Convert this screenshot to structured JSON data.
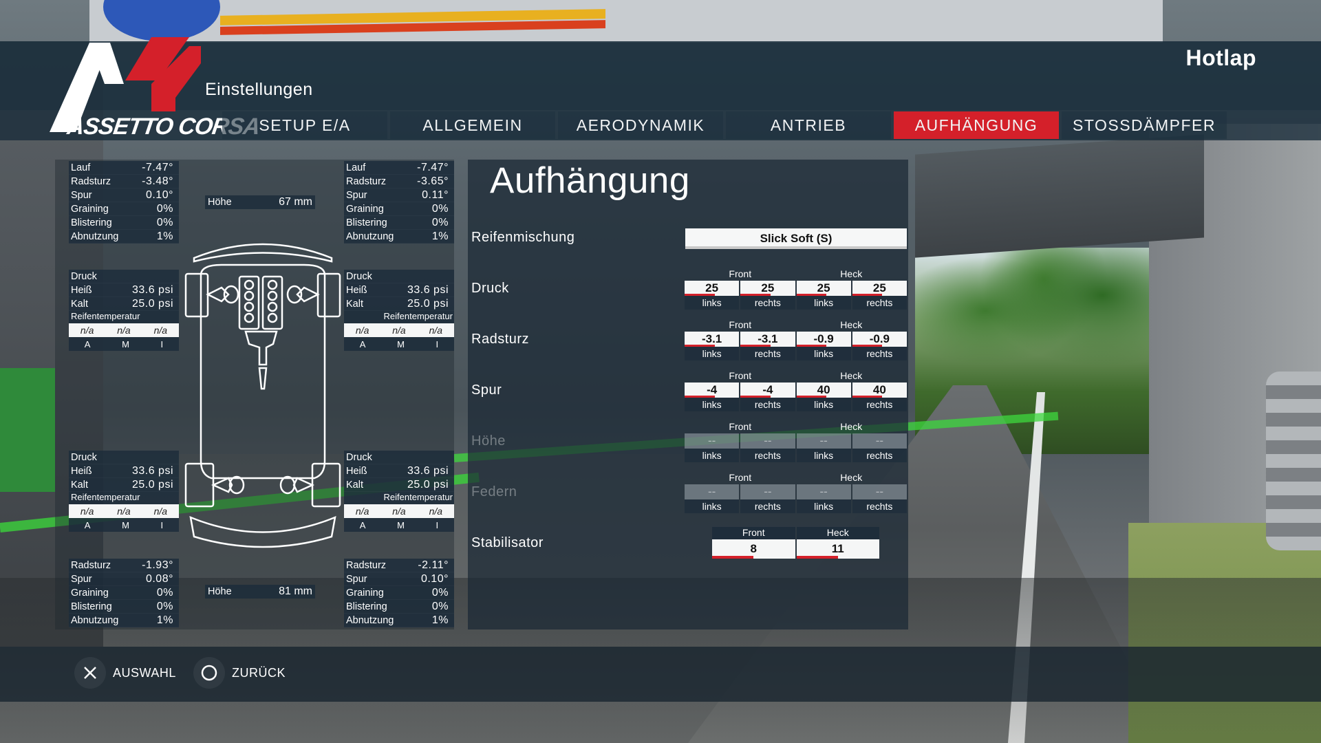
{
  "app": {
    "logo_text": "ASSETTO CORSA",
    "section_title": "Einstellungen",
    "mode": "Hotlap"
  },
  "tabs": [
    {
      "label": "SETUP E/A",
      "active": false
    },
    {
      "label": "ALLGEMEIN",
      "active": false
    },
    {
      "label": "AERODYNAMIK",
      "active": false
    },
    {
      "label": "ANTRIEB",
      "active": false
    },
    {
      "label": "AUFHÄNGUNG",
      "active": true
    },
    {
      "label": "STOSSDÄMPFER",
      "active": false
    }
  ],
  "telemetry": {
    "front_left": {
      "lauf_label": "Lauf",
      "lauf": "-7.47°",
      "radsturz_label": "Radsturz",
      "radsturz": "-3.48°",
      "spur_label": "Spur",
      "spur": "0.10°",
      "graining_label": "Graining",
      "graining": "0%",
      "blistering_label": "Blistering",
      "blistering": "0%",
      "abnutzung_label": "Abnutzung",
      "abnutzung": "1%",
      "druck_label": "Druck",
      "heiss_label": "Heiß",
      "heiss": "33.6 psi",
      "kalt_label": "Kalt",
      "kalt": "25.0 psi",
      "temp_label": "Reifentemperatur",
      "temps": [
        "n/a",
        "n/a",
        "n/a"
      ],
      "zones": [
        "A",
        "M",
        "I"
      ]
    },
    "front_right": {
      "lauf_label": "Lauf",
      "lauf": "-7.47°",
      "radsturz_label": "Radsturz",
      "radsturz": "-3.65°",
      "spur_label": "Spur",
      "spur": "0.11°",
      "graining_label": "Graining",
      "graining": "0%",
      "blistering_label": "Blistering",
      "blistering": "0%",
      "abnutzung_label": "Abnutzung",
      "abnutzung": "1%",
      "druck_label": "Druck",
      "heiss_label": "Heiß",
      "heiss": "33.6 psi",
      "kalt_label": "Kalt",
      "kalt": "25.0 psi",
      "temp_label": "Reifentemperatur",
      "temps": [
        "n/a",
        "n/a",
        "n/a"
      ],
      "zones": [
        "A",
        "M",
        "I"
      ]
    },
    "rear_left": {
      "druck_label": "Druck",
      "heiss_label": "Heiß",
      "heiss": "33.6 psi",
      "kalt_label": "Kalt",
      "kalt": "25.0 psi",
      "temp_label": "Reifentemperatur",
      "temps": [
        "n/a",
        "n/a",
        "n/a"
      ],
      "zones": [
        "A",
        "M",
        "I"
      ],
      "radsturz_label": "Radsturz",
      "radsturz": "-1.93°",
      "spur_label": "Spur",
      "spur": "0.08°",
      "graining_label": "Graining",
      "graining": "0%",
      "blistering_label": "Blistering",
      "blistering": "0%",
      "abnutzung_label": "Abnutzung",
      "abnutzung": "1%"
    },
    "rear_right": {
      "druck_label": "Druck",
      "heiss_label": "Heiß",
      "heiss": "33.6 psi",
      "kalt_label": "Kalt",
      "kalt": "25.0 psi",
      "temp_label": "Reifentemperatur",
      "temps": [
        "n/a",
        "n/a",
        "n/a"
      ],
      "zones": [
        "A",
        "M",
        "I"
      ],
      "radsturz_label": "Radsturz",
      "radsturz": "-2.11°",
      "spur_label": "Spur",
      "spur": "0.10°",
      "graining_label": "Graining",
      "graining": "0%",
      "blistering_label": "Blistering",
      "blistering": "0%",
      "abnutzung_label": "Abnutzung",
      "abnutzung": "1%"
    },
    "hoehe_front": {
      "label": "Höhe",
      "value": "67 mm"
    },
    "hoehe_rear": {
      "label": "Höhe",
      "value": "81 mm"
    }
  },
  "suspension": {
    "title": "Aufhängung",
    "reifenmischung": {
      "label": "Reifenmischung",
      "value": "Slick Soft (S)"
    },
    "front_label": "Front",
    "heck_label": "Heck",
    "links_label": "links",
    "rechts_label": "rechts",
    "druck": {
      "label": "Druck",
      "values": [
        "25",
        "25",
        "25",
        "25"
      ]
    },
    "radsturz": {
      "label": "Radsturz",
      "values": [
        "-3.1",
        "-3.1",
        "-0.9",
        "-0.9"
      ]
    },
    "spur": {
      "label": "Spur",
      "values": [
        "-4",
        "-4",
        "40",
        "40"
      ]
    },
    "hoehe": {
      "label": "Höhe",
      "values": [
        "--",
        "--",
        "--",
        "--"
      ]
    },
    "federn": {
      "label": "Federn",
      "values": [
        "--",
        "--",
        "--",
        "--"
      ]
    },
    "stabilisator": {
      "label": "Stabilisator",
      "values": [
        "8",
        "11"
      ]
    }
  },
  "footer": {
    "auswahl": "AUSWAHL",
    "zurueck": "ZURÜCK"
  },
  "colors": {
    "accent": "#d4202a",
    "panel": "#1c2c3a"
  }
}
